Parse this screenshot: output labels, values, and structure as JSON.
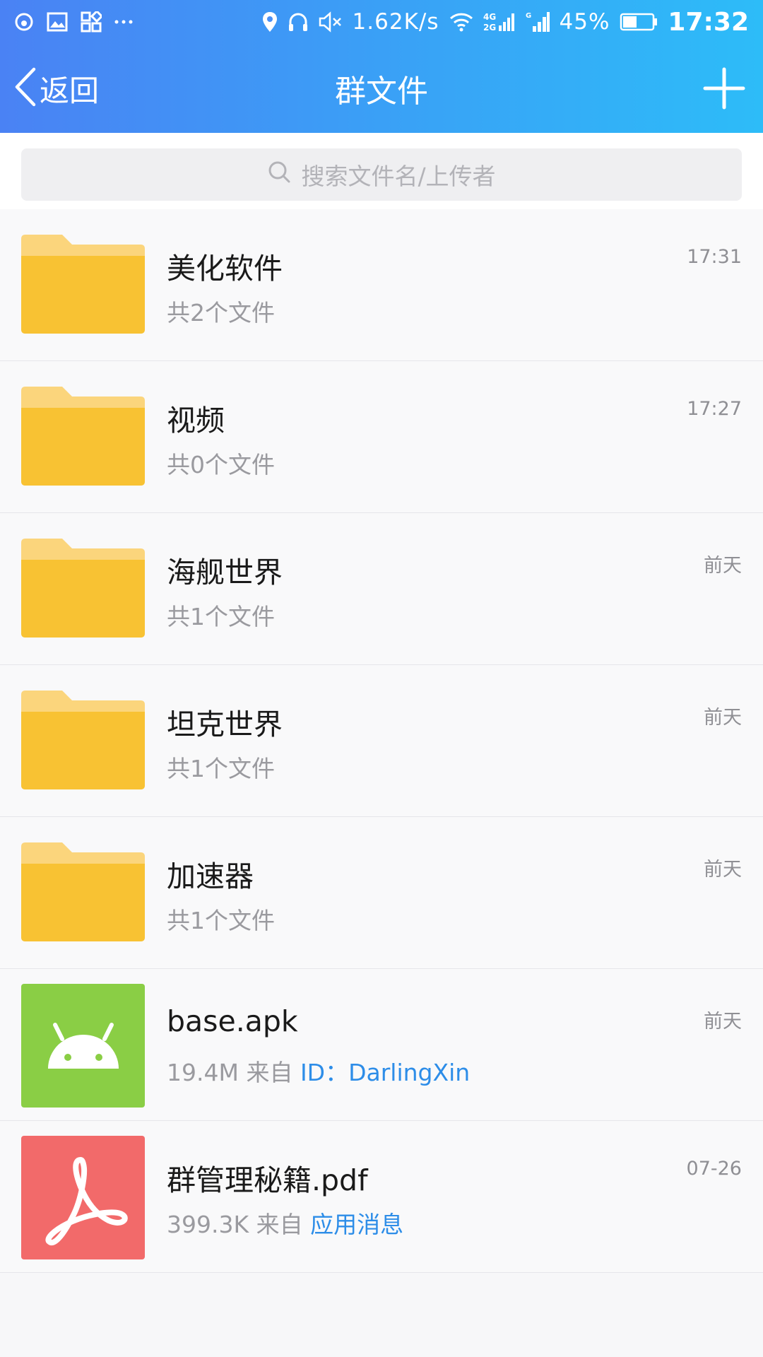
{
  "status_bar": {
    "speed": "1.62K/s",
    "network": "4G 2G",
    "battery": "45%",
    "time": "17:32",
    "icons": [
      "notification-icon",
      "gallery-icon",
      "app-icon",
      "more-icon",
      "location-icon",
      "headphone-icon",
      "mute-icon",
      "wifi-icon",
      "signal-icon",
      "battery-icon"
    ]
  },
  "header": {
    "back_label": "返回",
    "title": "群文件"
  },
  "search": {
    "placeholder": "搜索文件名/上传者"
  },
  "items": [
    {
      "type": "folder",
      "name": "美化软件",
      "sub": "共2个文件",
      "time": "17:31"
    },
    {
      "type": "folder",
      "name": "视频",
      "sub": "共0个文件",
      "time": "17:27"
    },
    {
      "type": "folder",
      "name": "海舰世界",
      "sub": "共1个文件",
      "time": "前天"
    },
    {
      "type": "folder",
      "name": "坦克世界",
      "sub": "共1个文件",
      "time": "前天"
    },
    {
      "type": "folder",
      "name": "加速器",
      "sub": "共1个文件",
      "time": "前天"
    },
    {
      "type": "apk",
      "name": "base.apk",
      "size": "19.4M",
      "from": "来自",
      "uploader": "ID：DarlingXin",
      "time": "前天"
    },
    {
      "type": "pdf",
      "name": "群管理秘籍.pdf",
      "size": "399.3K",
      "from": "来自",
      "uploader": "应用消息",
      "time": "07-26"
    }
  ],
  "colors": {
    "header_gradient_start": "#4a82f4",
    "header_gradient_end": "#2dbcf8",
    "folder_yellow": "#f8c233",
    "apk_green": "#8ace45",
    "pdf_red": "#f26a6a",
    "link_blue": "#2d8de8"
  }
}
